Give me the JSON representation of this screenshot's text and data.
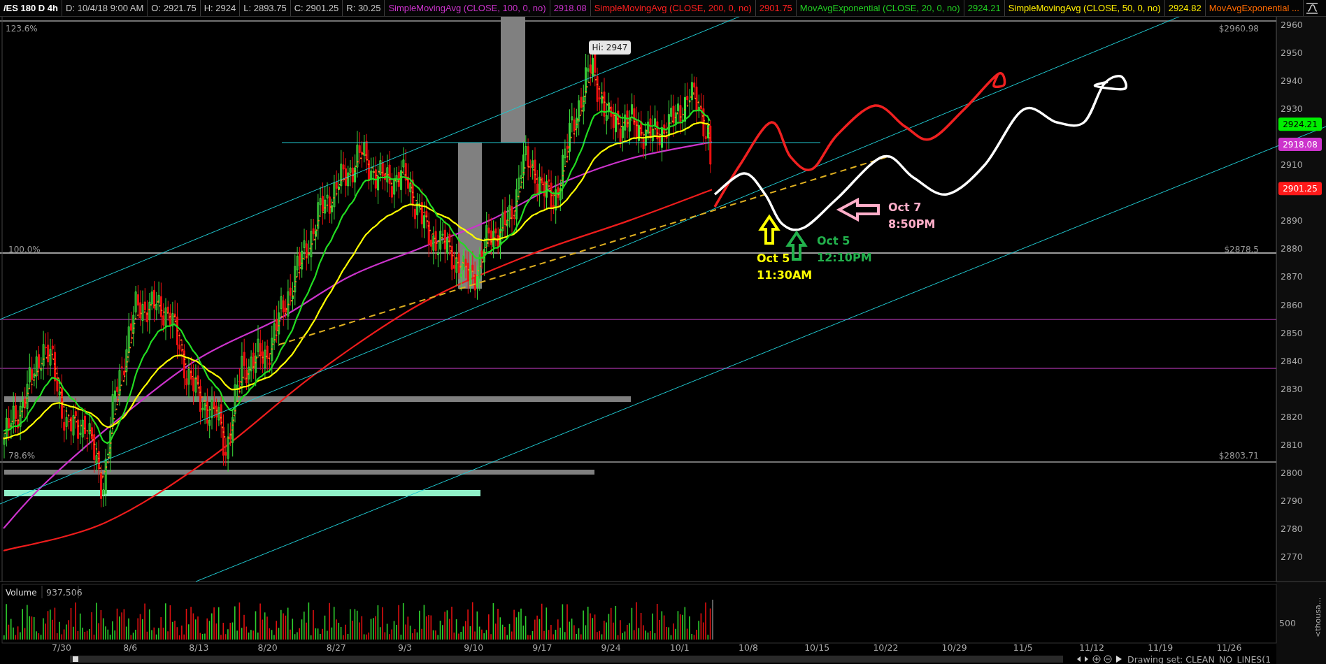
{
  "header": {
    "symbol": "/ES 180 D 4h",
    "cells": [
      "D: 10/4/18 9:00 AM",
      "O: 2921.75",
      "H: 2924",
      "L: 2893.75",
      "C: 2901.25",
      "R: 30.25"
    ],
    "studies": [
      {
        "label": "SimpleMovingAvg (CLOSE, 100, 0, no)",
        "value": "2918.08",
        "color": "#cc33cc"
      },
      {
        "label": "SimpleMovingAvg (CLOSE, 200, 0, no)",
        "value": "2901.75",
        "color": "#ff2020"
      },
      {
        "label": "MovAvgExponential (CLOSE, 20, 0, no)",
        "value": "2924.21",
        "color": "#22cc22"
      },
      {
        "label": "SimpleMovingAvg (CLOSE, 50, 0, no)",
        "value": "2924.82",
        "color": "#ffee00"
      },
      {
        "label": "MovAvgExponential ...",
        "color": "#ff6a00"
      }
    ]
  },
  "price_axis": {
    "ticks": [
      "2960",
      "2950",
      "2940",
      "2930",
      "2910",
      "2890",
      "2880",
      "2870",
      "2860",
      "2850",
      "2840",
      "2830",
      "2820",
      "2810",
      "2800",
      "2790",
      "2780",
      "2770"
    ],
    "tags": [
      {
        "value": "2924.21",
        "color": "#00ee00"
      },
      {
        "value": "2918.08",
        "color": "#cc33cc"
      },
      {
        "value": "2901.25",
        "color": "#ff1a1a"
      }
    ]
  },
  "levels": [
    {
      "label": "123.6%"
    },
    {
      "label": "$2960.98"
    },
    {
      "label": "100.0%"
    },
    {
      "label": "$2878.5"
    },
    {
      "label": "78.6%"
    },
    {
      "label": "$2803.71"
    }
  ],
  "high_label": "Hi: 2947",
  "annotations": [
    {
      "lines": [
        "Oct 5",
        "11:30AM"
      ],
      "color": "#ffff00"
    },
    {
      "lines": [
        "Oct 5",
        "12:10PM"
      ],
      "color": "#22b14c"
    },
    {
      "lines": [
        "Oct 7",
        "8:50PM"
      ],
      "color": "#ffaec9"
    }
  ],
  "volume": {
    "title": "Volume",
    "value": "937,506",
    "axis_label": "500",
    "unit_label": "<thousa..."
  },
  "time_axis": [
    "7/30",
    "8/6",
    "8/13",
    "8/20",
    "8/27",
    "9/3",
    "9/10",
    "9/17",
    "9/24",
    "10/1",
    "10/8",
    "10/15",
    "10/22",
    "10/29",
    "11/5",
    "11/12",
    "11/19",
    "11/26"
  ],
  "status": {
    "drawing_set": "Drawing set: CLEAN_NO_LINES(1"
  }
}
